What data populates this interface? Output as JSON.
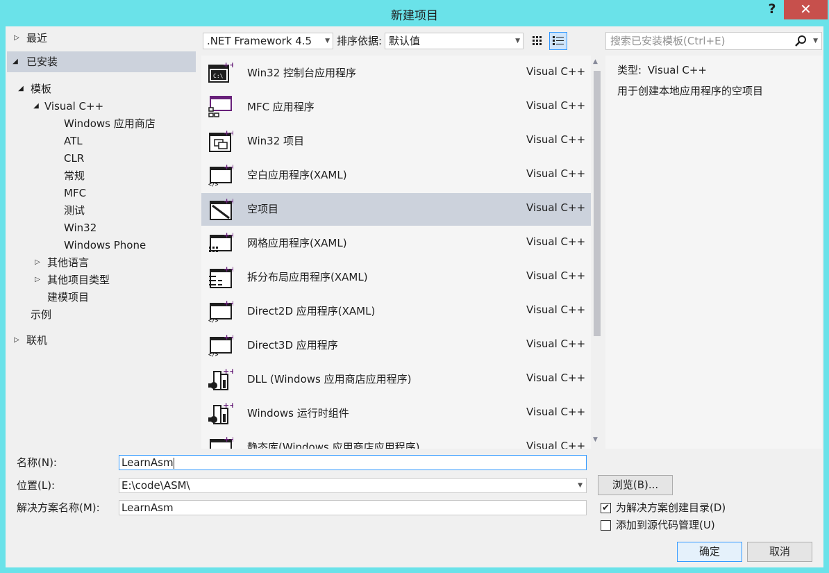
{
  "window": {
    "title": "新建项目",
    "help": "?",
    "close": "✕"
  },
  "tree": {
    "recent": "最近",
    "installed": "已安装",
    "templates": "模板",
    "visual_cpp": "Visual C++",
    "children": [
      "Windows 应用商店",
      "ATL",
      "CLR",
      "常规",
      "MFC",
      "测试",
      "Win32",
      "Windows Phone"
    ],
    "other_languages": "其他语言",
    "other_project_types": "其他项目类型",
    "modeling_projects": "建模项目",
    "samples": "示例",
    "online": "联机"
  },
  "toolbar": {
    "framework": ".NET Framework 4.5",
    "sort_label": "排序依据:",
    "sort_value": "默认值"
  },
  "templates": [
    {
      "name": "Win32 控制台应用程序",
      "lang": "Visual C++",
      "icon": "console-app-icon"
    },
    {
      "name": "MFC 应用程序",
      "lang": "Visual C++",
      "icon": "mfc-app-icon"
    },
    {
      "name": "Win32 项目",
      "lang": "Visual C++",
      "icon": "win32-project-icon"
    },
    {
      "name": "空白应用程序(XAML)",
      "lang": "Visual C++",
      "icon": "blank-xaml-app-icon"
    },
    {
      "name": "空项目",
      "lang": "Visual C++",
      "icon": "empty-project-icon"
    },
    {
      "name": "网格应用程序(XAML)",
      "lang": "Visual C++",
      "icon": "grid-xaml-app-icon"
    },
    {
      "name": "拆分布局应用程序(XAML)",
      "lang": "Visual C++",
      "icon": "split-xaml-app-icon"
    },
    {
      "name": "Direct2D 应用程序(XAML)",
      "lang": "Visual C++",
      "icon": "direct2d-app-icon"
    },
    {
      "name": "Direct3D 应用程序",
      "lang": "Visual C++",
      "icon": "direct3d-app-icon"
    },
    {
      "name": "DLL (Windows 应用商店应用程序)",
      "lang": "Visual C++",
      "icon": "dll-store-icon"
    },
    {
      "name": "Windows 运行时组件",
      "lang": "Visual C++",
      "icon": "winrt-component-icon"
    },
    {
      "name": "静态库(Windows 应用商店应用程序)",
      "lang": "Visual C++",
      "icon": "static-lib-icon"
    }
  ],
  "search": {
    "placeholder": "搜索已安装模板(Ctrl+E)"
  },
  "details": {
    "type_label": "类型:",
    "type_value": "Visual C++",
    "description": "用于创建本地应用程序的空项目"
  },
  "form": {
    "name_label": "名称(N):",
    "name_value": "LearnAsm",
    "location_label": "位置(L):",
    "location_value": "E:\\code\\ASM\\",
    "solution_label": "解决方案名称(M):",
    "solution_value": "LearnAsm",
    "browse": "浏览(B)...",
    "create_dir": "为解决方案创建目录(D)",
    "create_dir_checked": true,
    "add_scc": "添加到源代码管理(U)",
    "add_scc_checked": false,
    "ok": "确定",
    "cancel": "取消"
  }
}
